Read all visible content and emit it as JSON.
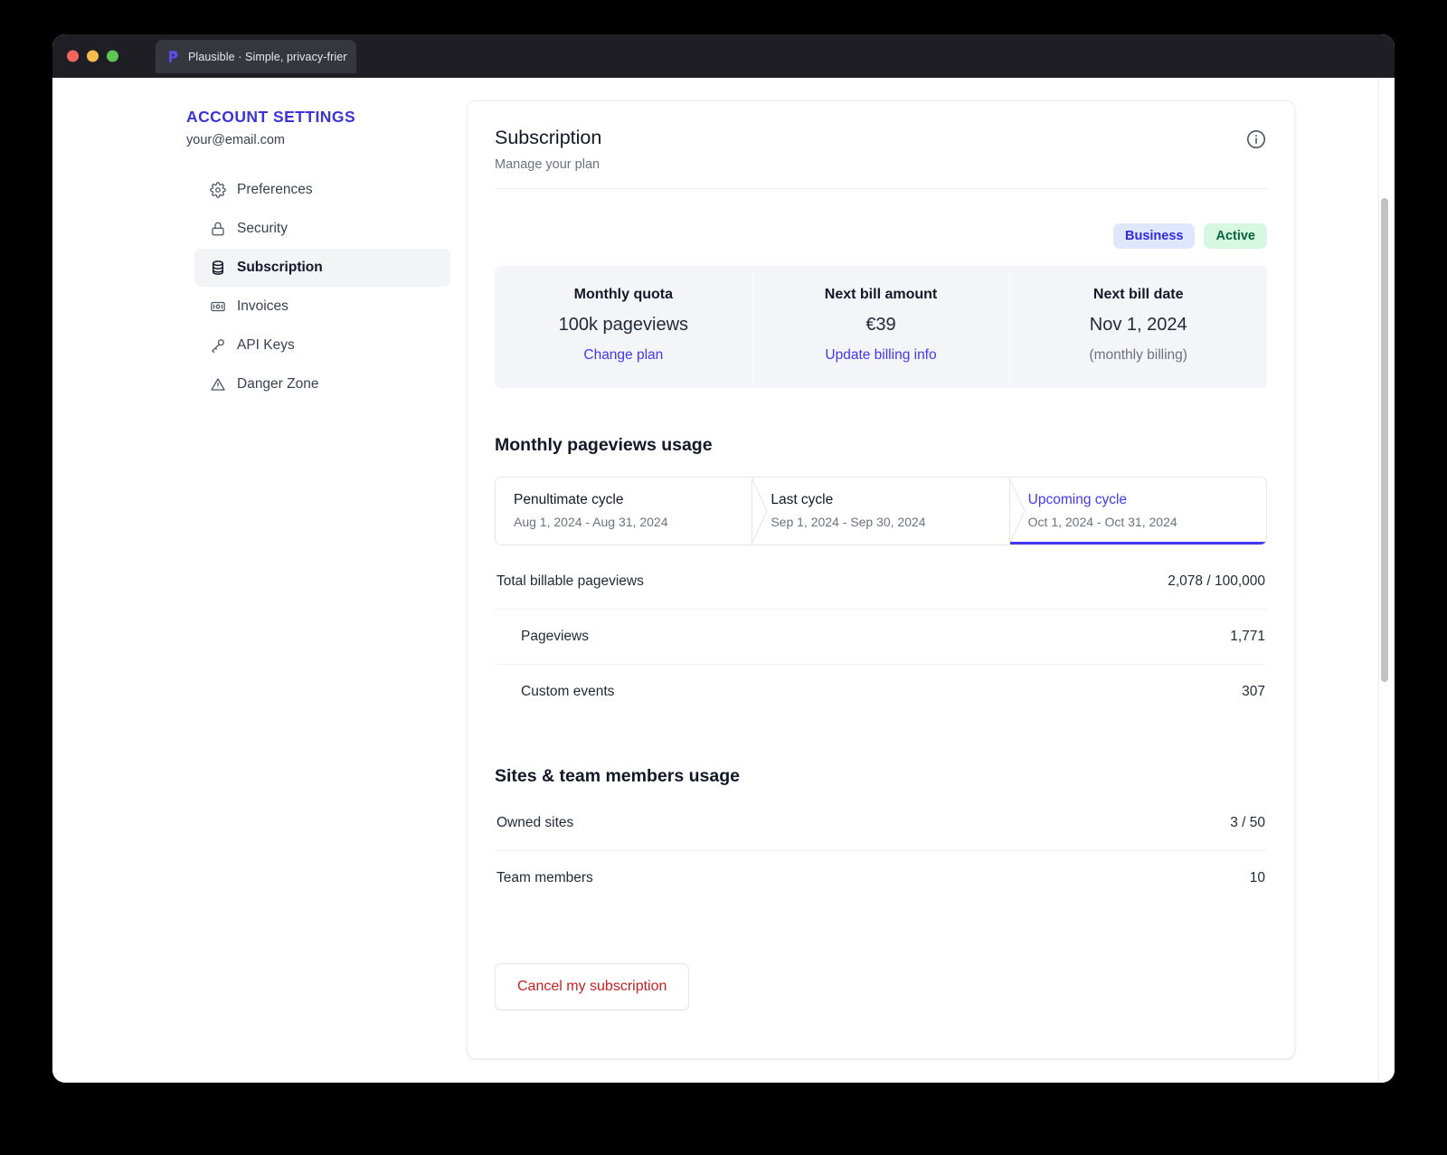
{
  "browser": {
    "tab_title": "Plausible · Simple, privacy-friend",
    "favicon": "plausible-logo-icon",
    "traffic_lights": [
      "close-button",
      "minimize-button",
      "maximize-button"
    ]
  },
  "sidebar": {
    "heading": "ACCOUNT SETTINGS",
    "email": "your@email.com",
    "items": [
      {
        "label": "Preferences",
        "icon": "gear-icon",
        "active": false
      },
      {
        "label": "Security",
        "icon": "lock-icon",
        "active": false
      },
      {
        "label": "Subscription",
        "icon": "database-icon",
        "active": true
      },
      {
        "label": "Invoices",
        "icon": "banknote-icon",
        "active": false
      },
      {
        "label": "API Keys",
        "icon": "key-icon",
        "active": false
      },
      {
        "label": "Danger Zone",
        "icon": "warning-triangle-icon",
        "active": false
      }
    ]
  },
  "card": {
    "title": "Subscription",
    "subtitle": "Manage your plan",
    "info_icon": "info-circle-icon",
    "badges": {
      "plan": "Business",
      "status": "Active",
      "plan_bg": "#dfe7fe",
      "plan_fg": "#312ae0",
      "status_bg": "#d6f8e2",
      "status_fg": "#07653a"
    },
    "stats": [
      {
        "label": "Monthly quota",
        "value": "100k pageviews",
        "link": "Change plan",
        "note": ""
      },
      {
        "label": "Next bill amount",
        "value": "€39",
        "link": "Update billing info",
        "note": ""
      },
      {
        "label": "Next bill date",
        "value": "Nov 1, 2024",
        "link": "",
        "note": "(monthly billing)"
      }
    ],
    "pageviews_section": {
      "title": "Monthly pageviews usage",
      "cycles": [
        {
          "name": "Penultimate cycle",
          "range": "Aug 1, 2024 - Aug 31, 2024",
          "active": false
        },
        {
          "name": "Last cycle",
          "range": "Sep 1, 2024 - Sep 30, 2024",
          "active": false
        },
        {
          "name": "Upcoming cycle",
          "range": "Oct 1, 2024 - Oct 31, 2024",
          "active": true
        }
      ],
      "rows": [
        {
          "label": "Total billable pageviews",
          "value": "2,078 / 100,000",
          "indent": false
        },
        {
          "label": "Pageviews",
          "value": "1,771",
          "indent": true
        },
        {
          "label": "Custom events",
          "value": "307",
          "indent": true
        }
      ]
    },
    "sites_section": {
      "title": "Sites & team members usage",
      "rows": [
        {
          "label": "Owned sites",
          "value": "3 / 50"
        },
        {
          "label": "Team members",
          "value": "10"
        }
      ]
    },
    "cancel_button": "Cancel my subscription",
    "cancel_color": "#c71f1f"
  },
  "scrollbar": {
    "name": "vertical-scrollbar"
  },
  "accent": {
    "primary": "#4338f0",
    "heading": "#3b34d6"
  }
}
